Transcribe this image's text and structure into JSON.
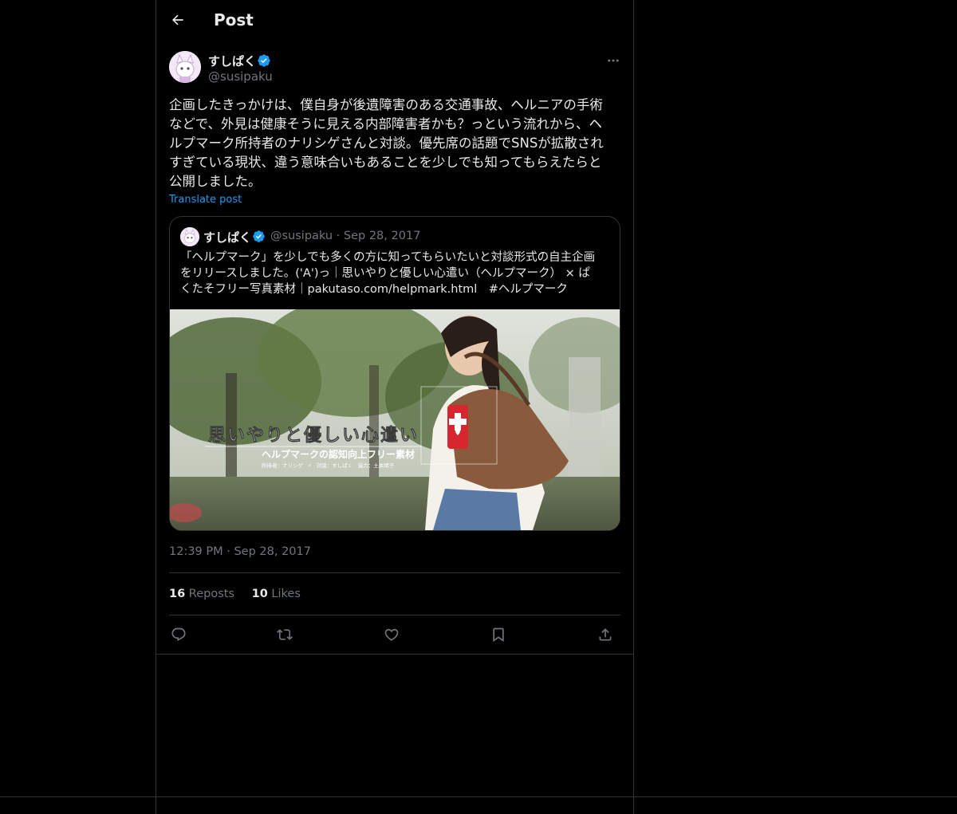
{
  "header": {
    "title": "Post"
  },
  "post": {
    "author_name": "すしぱく",
    "author_handle": "@susipaku",
    "text": "企画したきっかけは、僕自身が後遺障害のある交通事故、ヘルニアの手術\nなどで、外見は健康そうに見える内部障害者かも？っという流れから、ヘ\nルプマーク所持者のナリシゲさんと対談。優先席の話題でSNSが拡散され\nすぎている現状、違う意味合いもあることを少しでも知ってもらえたらと\n公開しました。",
    "translate_label": "Translate post",
    "timestamp": "12:39 PM · Sep 28, 2017",
    "reposts_count": "16",
    "reposts_label": "Reposts",
    "likes_count": "10",
    "likes_label": "Likes"
  },
  "quote": {
    "author_name": "すしぱく",
    "meta": "@susipaku · Sep 28, 2017",
    "text": "「ヘルプマーク」を少しでも多くの方に知ってもらいたいと対談形式の自主企画\nをリリースしました。('A')っ｜思いやりと優しい心遣い（ヘルプマーク） × ぱ\nくたそフリー写真素材｜pakutaso.com/helpmark.html　#ヘルプマーク",
    "image": {
      "title": "思いやりと優しい心遣い",
      "subtitle": "ヘルプマークの認知向上フリー素材",
      "credits": "所持者：ナリシゲ　×　対談：すしぱく　協力：土本晴子"
    }
  },
  "colors": {
    "background": "#000000",
    "border": "#2f3336",
    "text": "#e7e9ea",
    "muted": "#71767b",
    "accent": "#1d9bf0"
  },
  "icons": {
    "back": "arrow-left-icon",
    "verified": "verified-badge-icon",
    "more": "more-horizontal-icon",
    "reply": "reply-icon",
    "repost": "repost-icon",
    "like": "heart-icon",
    "bookmark": "bookmark-icon",
    "share": "share-icon"
  }
}
